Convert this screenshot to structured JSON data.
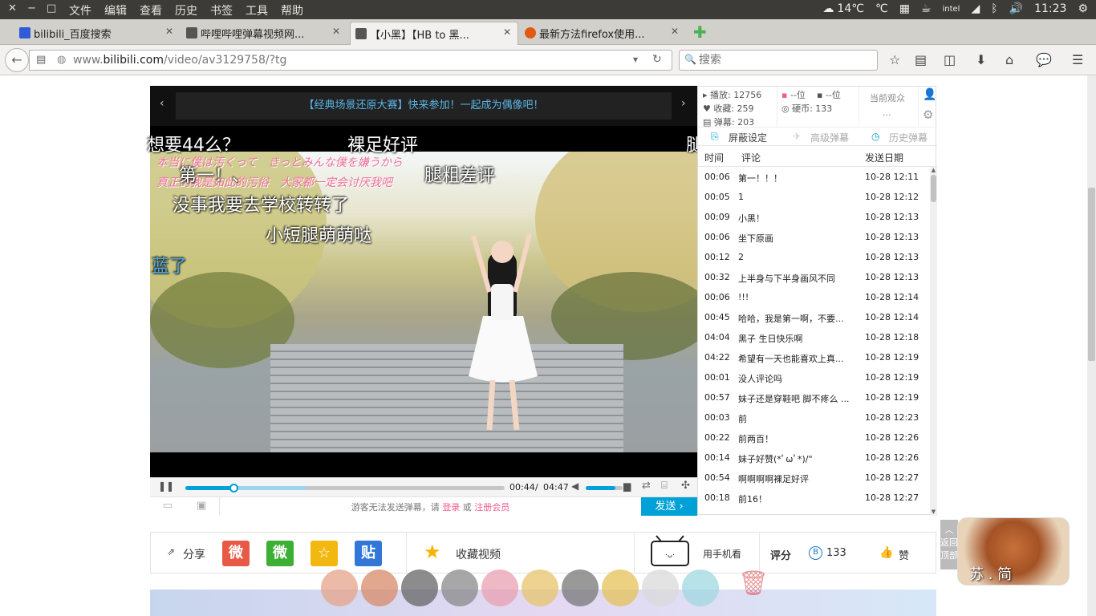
{
  "menubar": {
    "items": [
      "文件",
      "编辑",
      "查看",
      "历史",
      "书签",
      "工具",
      "帮助"
    ],
    "weather": "14℃",
    "time": "11:23"
  },
  "tabs": [
    {
      "label": "bilibili_百度搜索",
      "favicon_color": "#2f5bd8"
    },
    {
      "label": "哔哩哔哩弹幕视频网...",
      "favicon_color": "#555555"
    },
    {
      "label": "【小黑】【HB to 黑...",
      "favicon_color": "#555555",
      "active": true
    },
    {
      "label": "最新方法firefox使用...",
      "favicon_color": "#e05a12"
    }
  ],
  "newtab": "✚",
  "address": {
    "prefix": "www.",
    "domain": "bilibili.com",
    "path": "/video/av3129758/?tg"
  },
  "search": {
    "placeholder": "搜索"
  },
  "player": {
    "banner": "【经典场景还原大赛】快来参加！一起成为偶像吧！",
    "danmaku": [
      "想要44么？",
      "裸足好评",
      "腿",
      "第一！、",
      "腿粗差评",
      "没事我要去学校转转了",
      "小短腿萌萌哒",
      "蓝了"
    ],
    "handwritten_overlay": [
      "本当に僕は汚くって　きっとみんな僕を嫌うから",
      "真正的我是如此的污俗　大家都一定会讨厌我吧"
    ],
    "time_current": "00:44",
    "time_sep": "/",
    "time_total": "04:47",
    "progress_percent": 15,
    "buffered_percent": 38,
    "volume_percent": 80,
    "send_hint_prefix": "游客无法发送弹幕，请",
    "send_hint_login": "登录",
    "send_hint_or": "或",
    "send_hint_register": "注册会员",
    "send_button": "发送 ›"
  },
  "stats": {
    "plays": "播放: 12756",
    "favorites": "收藏: 259",
    "danmaku": "弹幕: 203",
    "rank1": "--位",
    "rank2": "--位",
    "coins": "硬币: 133",
    "viewers_label": "当前观众",
    "viewers_value": "..."
  },
  "panel_tabs": [
    "屏蔽设定",
    "高级弹幕",
    "历史弹幕"
  ],
  "list_header": {
    "time": "时间",
    "comment": "评论",
    "date": "发送日期"
  },
  "comments": [
    {
      "t": "00:06",
      "c": "第一！！！",
      "d": "10-28 12:11"
    },
    {
      "t": "00:05",
      "c": "1",
      "d": "10-28 12:12"
    },
    {
      "t": "00:09",
      "c": "小黑！",
      "d": "10-28 12:13"
    },
    {
      "t": "00:06",
      "c": "坐下原画",
      "d": "10-28 12:13"
    },
    {
      "t": "00:12",
      "c": "2",
      "d": "10-28 12:13"
    },
    {
      "t": "00:32",
      "c": "上半身与下半身画风不同",
      "d": "10-28 12:13"
    },
    {
      "t": "00:06",
      "c": "!!!",
      "d": "10-28 12:14"
    },
    {
      "t": "00:45",
      "c": "哈哈，我是第一啊，不要...",
      "d": "10-28 12:14"
    },
    {
      "t": "04:04",
      "c": "黑子 生日快乐啊",
      "d": "10-28 12:18"
    },
    {
      "t": "04:22",
      "c": "希望有一天也能喜欢上真...",
      "d": "10-28 12:19"
    },
    {
      "t": "00:01",
      "c": "没人评论吗",
      "d": "10-28 12:19"
    },
    {
      "t": "00:57",
      "c": "妹子还是穿鞋吧 脚不疼么 ...",
      "d": "10-28 12:19"
    },
    {
      "t": "00:03",
      "c": "前",
      "d": "10-28 12:23"
    },
    {
      "t": "00:22",
      "c": "前两百！",
      "d": "10-28 12:26"
    },
    {
      "t": "00:14",
      "c": "妹子好赞(*ﾟωﾟ*)/\"",
      "d": "10-28 12:26"
    },
    {
      "t": "00:54",
      "c": "啊啊啊啊裸足好评",
      "d": "10-28 12:27"
    },
    {
      "t": "00:18",
      "c": "前16！",
      "d": "10-28 12:27"
    }
  ],
  "share": {
    "share_label": "分享",
    "weibo": "微",
    "wechat": "微",
    "qzone": "☆",
    "tieba": "贴",
    "fav_label": "收藏视频",
    "phone_label": "用手机看",
    "rating_label": "评分",
    "coin_count": "133",
    "like_label": "赞"
  },
  "backtop": "返回顶部",
  "mascot_text": "苏 . 简",
  "colors": {
    "accent": "#00a1d6",
    "pink": "#f25d8e",
    "menubar": "#3c3b37"
  }
}
